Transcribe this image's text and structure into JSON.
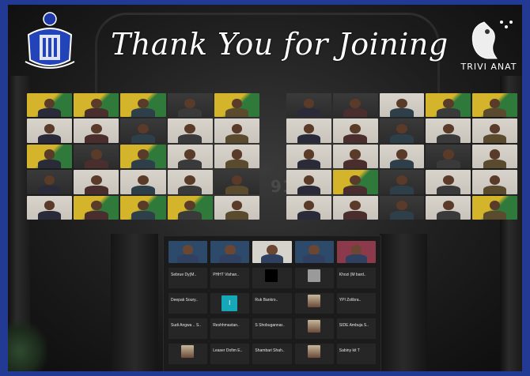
{
  "event": {
    "title": "Thank You for Joining",
    "right_logo_text": "TRIVI ANAT"
  },
  "backdrop": {
    "building_number": "913"
  },
  "colors": {
    "border_blue": "#233a94",
    "tile_yellow": "#d4b42a",
    "tile_green": "#2f7a3a",
    "tile_light": "#c9c4bb",
    "tile_dark": "#2c2c2c",
    "avatar_teal": "#16a8b8"
  },
  "gallery_left": [
    {
      "bg": "yellow-green"
    },
    {
      "bg": "yellow-green"
    },
    {
      "bg": "yellow-green"
    },
    {
      "bg": "dark"
    },
    {
      "bg": "yellow-green"
    },
    {
      "bg": "light"
    },
    {
      "bg": "light"
    },
    {
      "bg": "dark"
    },
    {
      "bg": "light"
    },
    {
      "bg": "light"
    },
    {
      "bg": "yellow-green"
    },
    {
      "bg": "dark"
    },
    {
      "bg": "yellow-green"
    },
    {
      "bg": "light"
    },
    {
      "bg": "light"
    },
    {
      "bg": "dark"
    },
    {
      "bg": "light"
    },
    {
      "bg": "light"
    },
    {
      "bg": "light"
    },
    {
      "bg": "dark"
    },
    {
      "bg": "light"
    },
    {
      "bg": "yellow-green"
    },
    {
      "bg": "yellow-green"
    },
    {
      "bg": "yellow-green"
    },
    {
      "bg": "light"
    }
  ],
  "gallery_right": [
    {
      "bg": "dark"
    },
    {
      "bg": "dark"
    },
    {
      "bg": "light"
    },
    {
      "bg": "yellow-green"
    },
    {
      "bg": "yellow-green"
    },
    {
      "bg": "light"
    },
    {
      "bg": "light"
    },
    {
      "bg": "dark"
    },
    {
      "bg": "light"
    },
    {
      "bg": "light"
    },
    {
      "bg": "light"
    },
    {
      "bg": "light"
    },
    {
      "bg": "light"
    },
    {
      "bg": "dark"
    },
    {
      "bg": "light"
    },
    {
      "bg": "light"
    },
    {
      "bg": "yellow-green"
    },
    {
      "bg": "dark"
    },
    {
      "bg": "light"
    },
    {
      "bg": "light"
    },
    {
      "bg": "light"
    },
    {
      "bg": "light"
    },
    {
      "bg": "dark"
    },
    {
      "bg": "light"
    },
    {
      "bg": "yellow-green"
    }
  ],
  "panel": {
    "video_row": [
      {
        "kind": "video"
      },
      {
        "kind": "video"
      },
      {
        "kind": "video"
      },
      {
        "kind": "video"
      },
      {
        "kind": "video"
      }
    ],
    "rows": [
      [
        {
          "label": "Sebrue Dy(M..",
          "kind": "text"
        },
        {
          "label": "PHHT Vishan..",
          "kind": "text"
        },
        {
          "label": "",
          "kind": "black"
        },
        {
          "label": "",
          "kind": "grey"
        },
        {
          "label": "Khozi (M bard..",
          "kind": "text"
        }
      ],
      [
        {
          "label": "Deepak Soury..",
          "kind": "text"
        },
        {
          "label": "I",
          "kind": "avatar"
        },
        {
          "label": "Ruk Bankro..",
          "kind": "text"
        },
        {
          "label": "",
          "kind": "thumb"
        },
        {
          "label": "YPI Zolibra..",
          "kind": "text"
        }
      ],
      [
        {
          "label": "Sudi Angwa .. S..",
          "kind": "text"
        },
        {
          "label": "Reshhmastan..",
          "kind": "text"
        },
        {
          "label": "S Shobugannar..",
          "kind": "text"
        },
        {
          "label": "",
          "kind": "thumb"
        },
        {
          "label": "SIDE Ambuja S..",
          "kind": "text"
        }
      ],
      [
        {
          "label": "",
          "kind": "thumb"
        },
        {
          "label": "Leaser Dofim E..",
          "kind": "text"
        },
        {
          "label": "Shambari Shah..",
          "kind": "text"
        },
        {
          "label": "",
          "kind": "thumb"
        },
        {
          "label": "Sabiny kit T",
          "kind": "text"
        }
      ]
    ]
  }
}
